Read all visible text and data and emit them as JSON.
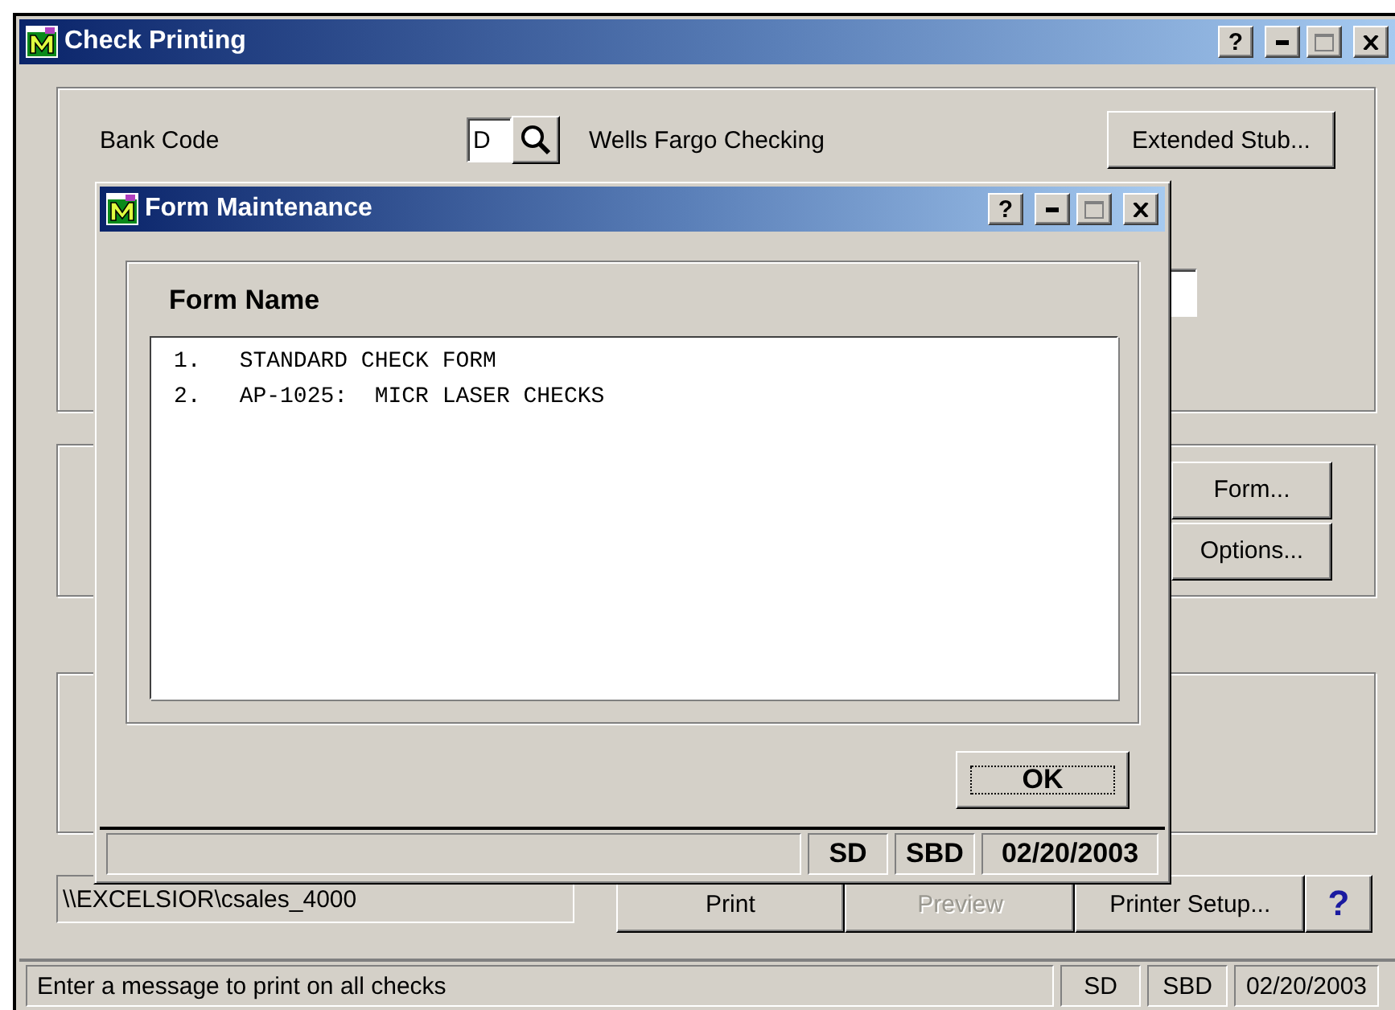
{
  "window": {
    "title": "Check Printing",
    "help_label": "?",
    "maximize_disabled": true
  },
  "bank": {
    "label": "Bank Code",
    "value": "D",
    "name": "Wells Fargo Checking"
  },
  "buttons": {
    "extended_stub": "Extended Stub...",
    "form": "Form...",
    "options": "Options..."
  },
  "path": "\\\\EXCELSIOR\\csales_4000",
  "actions": [
    {
      "label": "Print",
      "disabled": false
    },
    {
      "label": "Preview",
      "disabled": true
    },
    {
      "label": "Printer Setup...",
      "disabled": false
    }
  ],
  "help_button": "?",
  "status_bar": {
    "message": "Enter a message to print on all checks",
    "cells": [
      "SD",
      "SBD",
      "02/20/2003"
    ]
  },
  "dialog": {
    "title": "Form Maintenance",
    "help_label": "?",
    "maximize_disabled": true,
    "heading": "Form Name",
    "forms": [
      {
        "number": "1.",
        "name": "STANDARD CHECK FORM"
      },
      {
        "number": "2.",
        "name": "AP-1025:  MICR LASER CHECKS"
      }
    ],
    "ok": "OK",
    "status_bar": {
      "cells": [
        "SD",
        "SBD",
        "02/20/2003"
      ]
    }
  }
}
